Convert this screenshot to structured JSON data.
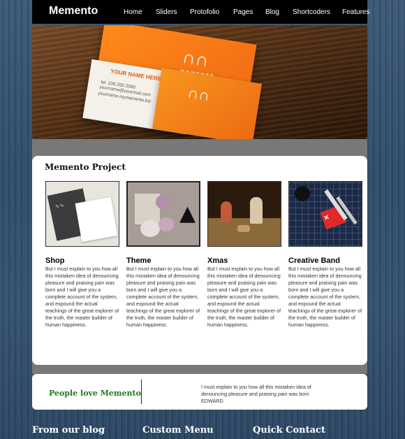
{
  "site": {
    "logo": "Memento"
  },
  "nav": {
    "items": [
      {
        "label": "Home"
      },
      {
        "label": "Sliders"
      },
      {
        "label": "Protofolio"
      },
      {
        "label": "Pages"
      },
      {
        "label": "Blog"
      },
      {
        "label": "Shortcoders"
      },
      {
        "label": "Features"
      }
    ]
  },
  "hero": {
    "card_name": "YOUR NAME HERE",
    "card_lines": [
      "tel. 100 200 2000",
      "yourname@yourmail.com",
      "yourname.mymemento.biz"
    ],
    "brand": "MOMENTS"
  },
  "project": {
    "title": "Memento Project",
    "items": [
      {
        "title": "Shop",
        "body": "But I must explain to you how all this mistaken idea of denouncing pleasure and praising pain was born and I will give you a complete account of the system, and expound the actual teachings of the great explorer of the truth, the master builder of human happiness."
      },
      {
        "title": "Theme",
        "body": "But I must explain to you how all this mistaken idea of denouncing pleasure and praising pain was born and I will give you a complete account of the system, and expound the actual teachings of the great explorer of the truth, the master builder of human happiness."
      },
      {
        "title": "Xmas",
        "body": "But I must explain to you how all this mistaken idea of denouncing pleasure and praising pain was born and I will give you a complete account of the system, and expound the actual teachings of the great explorer of the truth, the master builder of human happiness."
      },
      {
        "title": "Creative Band",
        "body": "But I must explain to you how all this mistaken idea of denouncing pleasure and praising pain was born and I will give you a complete account of the system, and expound the actual teachings of the great explorer of the truth, the master builder of human happiness."
      }
    ]
  },
  "testimonial": {
    "title": "People love Memento",
    "quote": "I must explain to you how all this mistaken idea of denouncing pleasure and praising pain was born",
    "author": "EDWARD"
  },
  "footer": {
    "blog_title": "From our blog",
    "menu_title": "Custom Menu",
    "contact_title": "Quick Contact"
  }
}
